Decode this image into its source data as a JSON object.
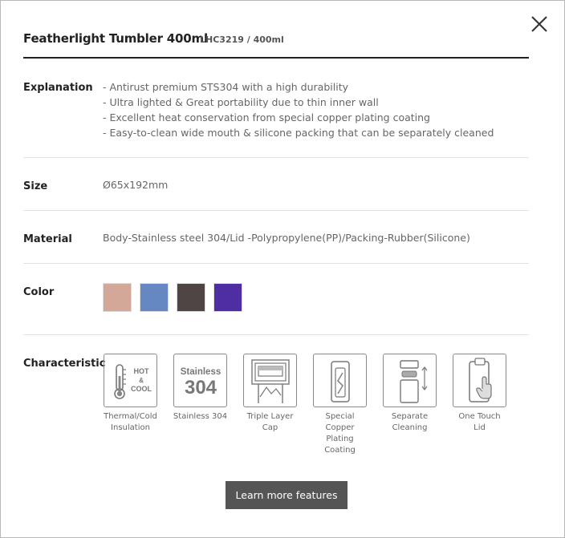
{
  "header": {
    "title": "Featherlight Tumbler 400ml",
    "subtitle": "LHC3219 / 400ml"
  },
  "explanation": {
    "label": "Explanation",
    "items": [
      "- Antirust premium STS304 with a high durability",
      "- Ultra lighted & Great portability due to thin inner wall",
      "- Excellent heat conservation from special copper plating coating",
      "- Easy-to-clean wide mouth & silicone packing that can be separately cleaned"
    ]
  },
  "size": {
    "label": "Size",
    "value": "Ø65x192mm"
  },
  "material": {
    "label": "Material",
    "value": "Body-Stainless steel 304/Lid -Polypropylene(PP)/Packing-Rubber(Silicone)"
  },
  "color": {
    "label": "Color",
    "swatches": [
      "#d4a898",
      "#6587c2",
      "#4f4545",
      "#4e2ea2"
    ]
  },
  "characteristic": {
    "label": "Characteristic",
    "features": [
      {
        "icon": "thermometer-icon",
        "label": "Thermal/Cold Insulation",
        "text": [
          "HOT",
          "&",
          "COOL"
        ]
      },
      {
        "icon": "stainless-304-icon",
        "label": "Stainless 304",
        "text": [
          "Stainless",
          "304"
        ]
      },
      {
        "icon": "triple-layer-cap-icon",
        "label": "Triple Layer Cap"
      },
      {
        "icon": "copper-plating-icon",
        "label": "Special Copper Plating Coating"
      },
      {
        "icon": "separate-cleaning-icon",
        "label": "Separate Cleaning"
      },
      {
        "icon": "one-touch-lid-icon",
        "label": "One Touch Lid"
      }
    ]
  },
  "learn_more": {
    "label": "Learn more features"
  }
}
